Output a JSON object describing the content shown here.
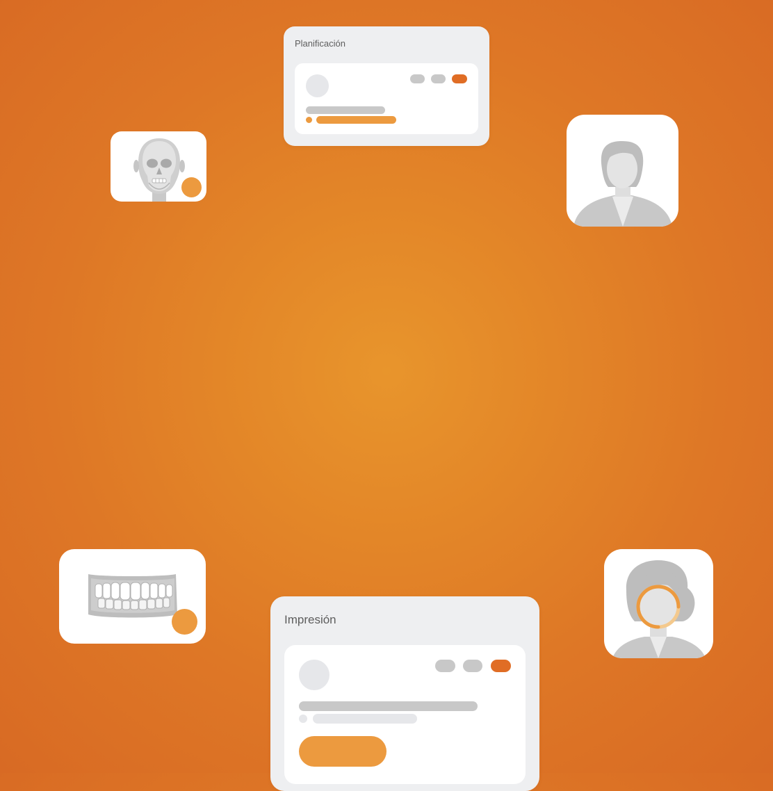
{
  "colors": {
    "background_center": "#e8952c",
    "background_edge": "#d86a24",
    "accent_orange": "#ec9a3f",
    "accent_dark_orange": "#e06d25",
    "placeholder_gray": "#c8c8c8",
    "placeholder_light": "#e6e7ea",
    "panel_bg": "#eeeff1",
    "card_bg": "#ffffff"
  },
  "planning_panel": {
    "title": "Planificación"
  },
  "print_panel": {
    "title": "Impresión"
  },
  "icons": {
    "skull_xray": "skull-xray-icon",
    "female_avatar": "female-avatar-icon",
    "dental_model": "teeth-model-icon",
    "face_scan": "face-scan-icon"
  }
}
